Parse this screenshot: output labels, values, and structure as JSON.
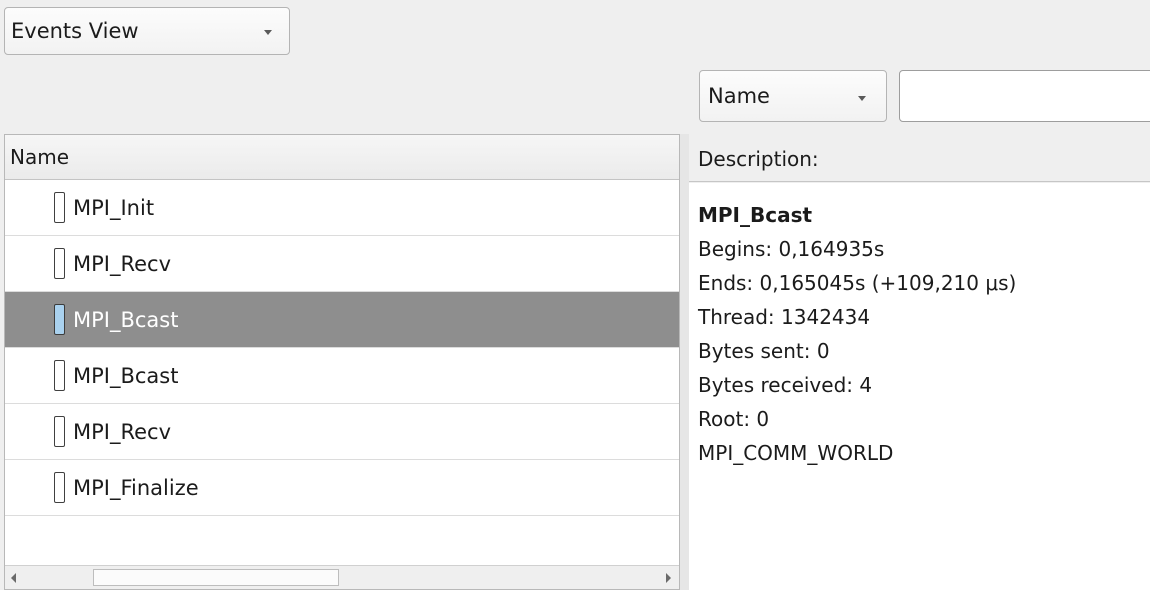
{
  "view_select": {
    "value": "Events View"
  },
  "filter": {
    "field": "Name",
    "query": ""
  },
  "list": {
    "header": "Name",
    "rows": [
      {
        "label": "MPI_Init",
        "selected": false
      },
      {
        "label": "MPI_Recv",
        "selected": false
      },
      {
        "label": "MPI_Bcast",
        "selected": true
      },
      {
        "label": "MPI_Bcast",
        "selected": false
      },
      {
        "label": "MPI_Recv",
        "selected": false
      },
      {
        "label": "MPI_Finalize",
        "selected": false
      }
    ]
  },
  "description": {
    "header": "Description:",
    "title": "MPI_Bcast",
    "lines": [
      "Begins: 0,164935s",
      "Ends: 0,165045s (+109,210 μs)",
      "Thread: 1342434",
      "Bytes sent: 0",
      "Bytes received: 4",
      "Root: 0",
      "MPI_COMM_WORLD"
    ]
  },
  "colors": {
    "selected_row_bg": "#8e8e8e",
    "selected_swatch": "#a9d1ee"
  }
}
